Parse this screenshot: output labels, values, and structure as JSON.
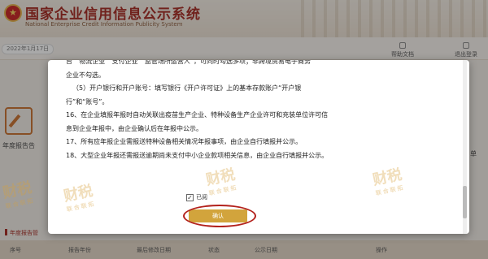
{
  "header": {
    "title_cn": "国家企业信用信息公示系统",
    "title_en": "National Enterprise Credit Information Publicity System"
  },
  "topbar": {
    "date": "2022年1月17日",
    "help": "帮助文档",
    "logout": "退出登录"
  },
  "background": {
    "card_left_label": "年度报告告",
    "card_right_label": "名单",
    "section_title": "年度报告管",
    "table_headers": [
      "序号",
      "报告年份",
      "最后修改日期",
      "状态",
      "公示日期",
      "操作"
    ]
  },
  "modal": {
    "lines": [
      "台”“物流企业”“支付企业”“监管场所运营人”，可同时勾选多项；非跨境贸易电子商务",
      "企业不勾选。",
      "（5）开户银行和开户账号：填写银行《开户许可证》上的基本存款账户“开户银",
      "行”和“账号”。",
      "16、在企业填报年报时自动关联出疫苗生产企业、特种设备生产企业许可和充装单位许可信",
      "息到企业年报中，由企业确认后在年报中公示。",
      "17、所有应年报企业需报送特种设备相关情况年报事项，由企业自行填报并公示。",
      "18、大型企业年报还需报送逾期尚未支付中小企业款项相关信息，由企业自行填报并公示。"
    ],
    "agree_label": "已阅",
    "agree_checked": "✓",
    "confirm_label": "确认"
  },
  "watermark": {
    "brand": "财税",
    "sub": "联合联拓"
  },
  "colors": {
    "brand_red": "#a3241c",
    "confirm_gold": "#d2a43c",
    "highlight_red": "#b3221d"
  }
}
